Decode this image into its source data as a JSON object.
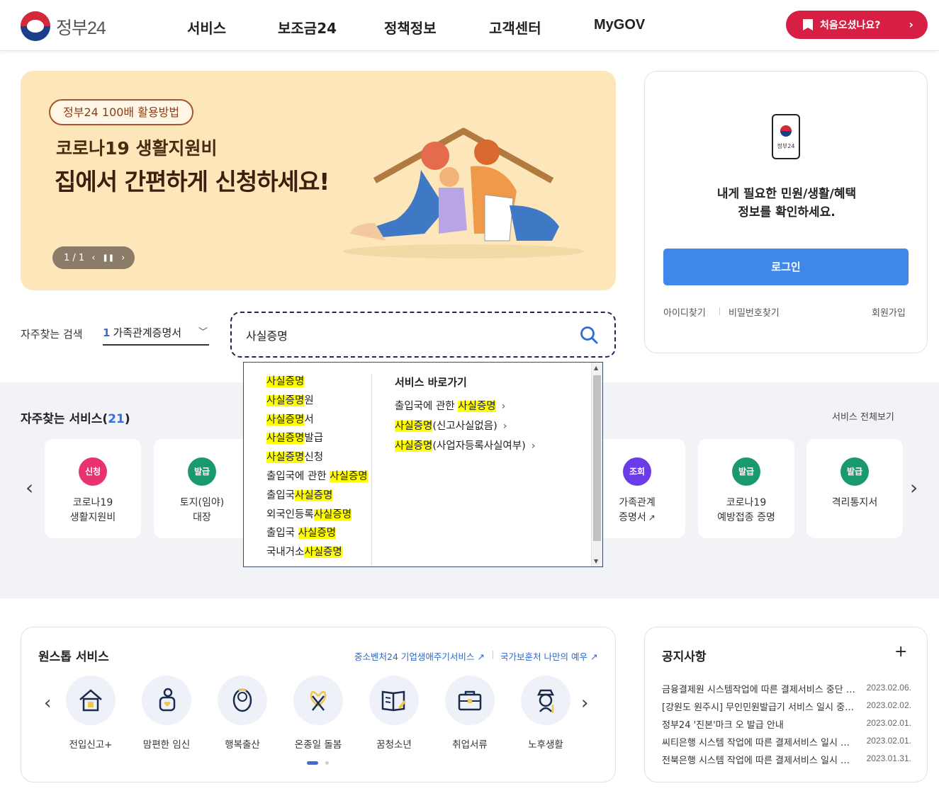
{
  "header": {
    "logo_text": "정부24",
    "nav": [
      "서비스",
      "보조금24",
      "정책정보",
      "고객센터",
      "MyGOV"
    ],
    "first_visit_label": "처음오셨나요?"
  },
  "banner": {
    "tag": "정부24 100배 활용방법",
    "subtitle": "코로나19 생활지원비",
    "title": "집에서 간편하게 신청하세요!",
    "pager": "1 / 1"
  },
  "login": {
    "phone_label": "정부24",
    "message_line1": "내게 필요한 민원/생활/혜택",
    "message_line2": "정보를 확인하세요.",
    "login_button": "로그인",
    "find_id": "아이디찾기",
    "find_password": "비밀번호찾기",
    "signup": "회원가입"
  },
  "search": {
    "frequent_label": "자주찾는 검색",
    "frequent_rank": "1",
    "frequent_value": "가족관계증명서",
    "input_value": "사실증명"
  },
  "autocomplete": {
    "shortcut_title": "서비스 바로가기",
    "items": [
      {
        "pre": "",
        "hl": "사실증명",
        "post": ""
      },
      {
        "pre": "",
        "hl": "사실증명",
        "post": "원"
      },
      {
        "pre": "",
        "hl": "사실증명",
        "post": "서"
      },
      {
        "pre": "",
        "hl": "사실증명",
        "post": "발급"
      },
      {
        "pre": "",
        "hl": "사실증명",
        "post": "신청"
      },
      {
        "pre": "출입국에 관한 ",
        "hl": "사실증명",
        "post": ""
      },
      {
        "pre": "출입국",
        "hl": "사실증명",
        "post": ""
      },
      {
        "pre": "외국인등록",
        "hl": "사실증명",
        "post": ""
      },
      {
        "pre": "출입국 ",
        "hl": "사실증명",
        "post": ""
      },
      {
        "pre": "국내거소",
        "hl": "사실증명",
        "post": ""
      }
    ],
    "shortcuts": [
      {
        "pre": "출입국에 관한 ",
        "hl": "사실증명",
        "post": ""
      },
      {
        "pre": "",
        "hl": "사실증명",
        "post": "(신고사실없음)"
      },
      {
        "pre": "",
        "hl": "사실증명",
        "post": "(사업자등록사실여부)"
      }
    ]
  },
  "services": {
    "title": "자주찾는 서비스",
    "count": "21",
    "view_all": "서비스 전체보기",
    "cards": [
      {
        "badge": "신청",
        "color": "#e8336f",
        "line1": "코로나19",
        "line2": "생활지원비"
      },
      {
        "badge": "발급",
        "color": "#1a9a6c",
        "line1": "토지(임야)",
        "line2": "대장"
      },
      {
        "badge": "조회",
        "color": "#6a3be8",
        "line1": "가족관계",
        "line2": "증명서"
      },
      {
        "badge": "발급",
        "color": "#1a9a6c",
        "line1": "코로나19",
        "line2": "예방접종 증명"
      },
      {
        "badge": "발급",
        "color": "#1a9a6c",
        "line1": "격리통지서",
        "line2": ""
      }
    ]
  },
  "onestop": {
    "title": "원스톱 서비스",
    "link1": "중소벤처24 기업생애주기서비스",
    "link2": "국가보훈처 나만의 예우",
    "items": [
      "전입신고+",
      "맘편한 임신",
      "행복출산",
      "온종일 돌봄",
      "꿈청소년",
      "취업서류",
      "노후생활"
    ]
  },
  "notice": {
    "title": "공지사항",
    "rows": [
      {
        "title": "금융결제원 시스템작업에 따른 결제서비스 중단 안내",
        "date": "2023.02.06."
      },
      {
        "title": "[강원도 원주시] 무인민원발급기 서비스 일시 중지 안내",
        "date": "2023.02.02."
      },
      {
        "title": "정부24 '진본'마크 오 발급 안내",
        "date": "2023.02.01."
      },
      {
        "title": "씨티은행 시스템 작업에 따른 결제서비스 일시 중단 안내",
        "date": "2023.02.01."
      },
      {
        "title": "전북은행 시스템 작업에 따른 결제서비스 일시 중단 안내",
        "date": "2023.01.31."
      }
    ]
  }
}
